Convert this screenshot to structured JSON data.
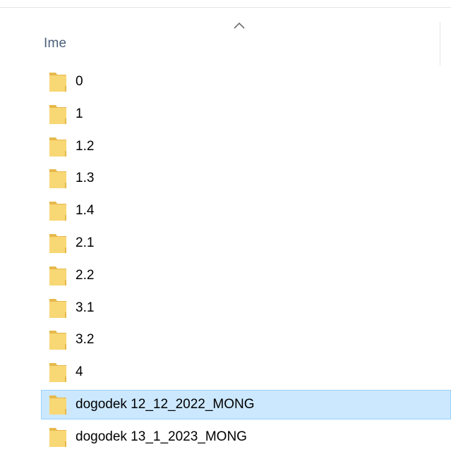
{
  "header": {
    "name_column": "Ime",
    "sort_icon": "chevron-up-icon"
  },
  "colors": {
    "folder": "#f8d775",
    "folder_shade": "#e6b84a",
    "selected_bg": "#cce8ff",
    "selected_border": "#99d1ff",
    "header_text": "#4c607a"
  },
  "folders": [
    {
      "name": "0",
      "icon": "folder-icon"
    },
    {
      "name": "1",
      "icon": "folder-icon"
    },
    {
      "name": "1.2",
      "icon": "folder-icon"
    },
    {
      "name": "1.3",
      "icon": "folder-icon"
    },
    {
      "name": "1.4",
      "icon": "folder-icon"
    },
    {
      "name": "2.1",
      "icon": "folder-icon"
    },
    {
      "name": "2.2",
      "icon": "folder-icon"
    },
    {
      "name": "3.1",
      "icon": "folder-icon"
    },
    {
      "name": "3.2",
      "icon": "folder-icon"
    },
    {
      "name": "4",
      "icon": "folder-icon"
    },
    {
      "name": "dogodek 12_12_2022_MONG",
      "icon": "folder-icon",
      "selected": true
    },
    {
      "name": "dogodek 13_1_2023_MONG",
      "icon": "folder-icon"
    }
  ]
}
